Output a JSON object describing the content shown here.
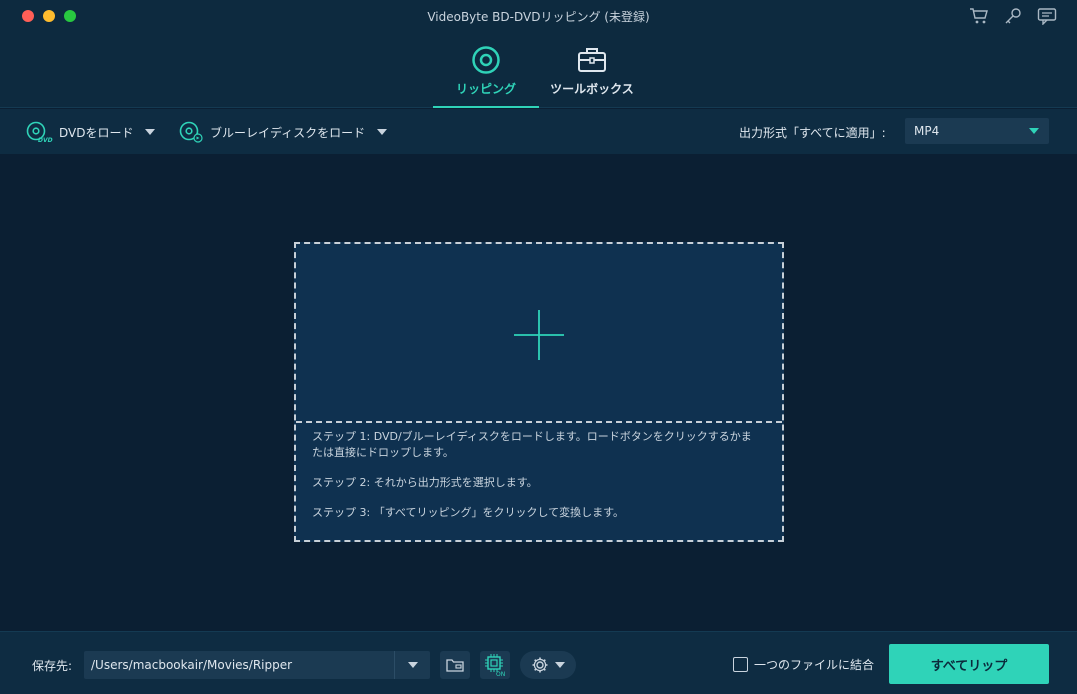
{
  "window": {
    "title": "VideoByte BD-DVDリッピング (未登録)"
  },
  "top_icons": [
    "cart-icon",
    "key-icon",
    "feedback-icon"
  ],
  "tabs": [
    {
      "label": "リッピング",
      "icon": "disc-icon",
      "active": true
    },
    {
      "label": "ツールボックス",
      "icon": "toolbox-icon",
      "active": false
    }
  ],
  "toolbar": {
    "load_dvd_label": "DVDをロード",
    "load_bluray_label": "ブルーレイディスクをロード",
    "format_label": "出力形式「すべてに適用」:",
    "format_value": "MP4"
  },
  "dropzone": {
    "step1": "ステップ 1: DVD/ブルーレイディスクをロードします。ロードボタンをクリックするかまたは直接にドロップします。",
    "step2": "ステップ 2: それから出力形式を選択します。",
    "step3": "ステップ 3: 「すべてリッピング」をクリックして変換します。"
  },
  "bottombar": {
    "save_label": "保存先:",
    "save_path": "/Users/macbookair/Movies/Ripper",
    "hw_badge": "ON",
    "merge_label": "一つのファイルに結合",
    "rip_all_label": "すべてリップ"
  },
  "colors": {
    "accent": "#2fd3b8",
    "background": "#0b1f33",
    "panel": "#0e2c42"
  }
}
